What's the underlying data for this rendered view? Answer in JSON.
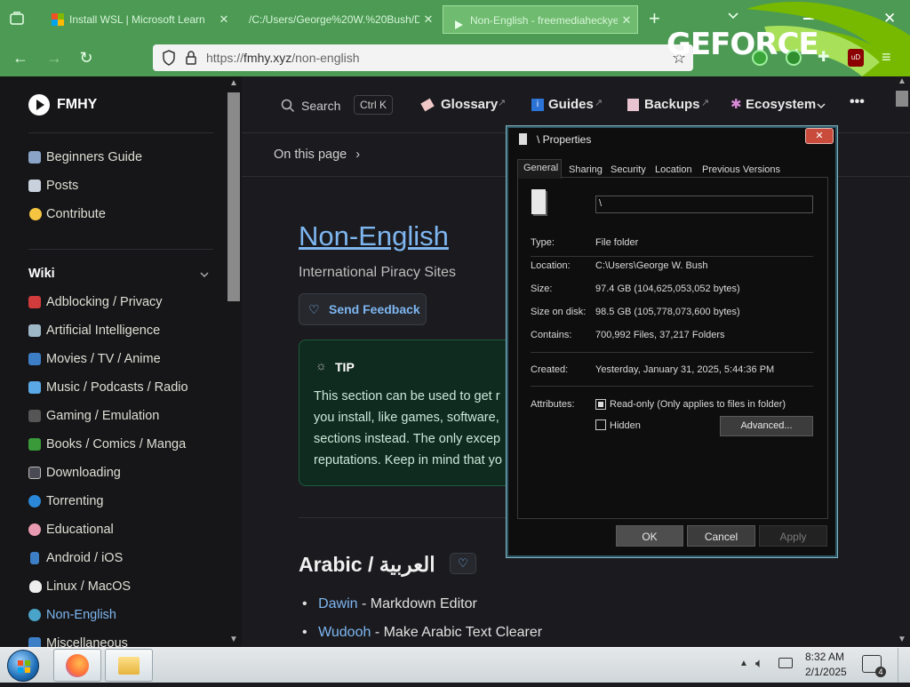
{
  "browser": {
    "tabs": [
      {
        "title": "Install WSL | Microsoft Learn",
        "active": false
      },
      {
        "title": "/C:/Users/George%20W.%20Bush/D",
        "active": false
      },
      {
        "title": "Non-English - freemediaheckyea",
        "active": true
      }
    ],
    "new_tab": "+",
    "url": {
      "prefix": "https://",
      "domain": "fmhy.xyz",
      "path": "/non-english"
    },
    "overlay_brand": "GEFORCE",
    "extension_badge": "uD"
  },
  "site": {
    "logo_text": "FMHY",
    "search_label": "Search",
    "search_shortcut": "Ctrl K",
    "top_nav": [
      "Glossary",
      "Guides",
      "Backups",
      "Ecosystem"
    ],
    "more": "•••",
    "on_this_page": "On this page",
    "sidebar_top": [
      "Beginners Guide",
      "Posts",
      "Contribute"
    ],
    "wiki_label": "Wiki",
    "wiki_items": [
      "Adblocking / Privacy",
      "Artificial Intelligence",
      "Movies / TV / Anime",
      "Music / Podcasts / Radio",
      "Gaming / Emulation",
      "Books / Comics / Manga",
      "Downloading",
      "Torrenting",
      "Educational",
      "Android / iOS",
      "Linux / MacOS",
      "Non-English",
      "Miscellaneous"
    ],
    "active_item": "Non-English",
    "accent": "#7eb6f0",
    "page_title": "Non-English",
    "page_subtitle": "International Piracy Sites",
    "feedback_button": "Send Feedback",
    "tip": {
      "label": "TIP",
      "lines": [
        "This section can be used to get r",
        "you install, like games, software,",
        "sections instead. The only excep",
        "reputations. Keep in mind that yo"
      ]
    },
    "section_heading": "Arabic / العربية",
    "list": [
      {
        "link": "Dawin",
        "desc": " - Markdown Editor"
      },
      {
        "link": "Wudooh",
        "desc": " - Make Arabic Text Clearer"
      }
    ]
  },
  "dialog": {
    "title": "\\ Properties",
    "tabs": [
      "General",
      "Sharing",
      "Security",
      "Location",
      "Previous Versions"
    ],
    "name_value": "\\",
    "fields": [
      {
        "label": "Type:",
        "value": "File folder"
      },
      {
        "label": "Location:",
        "value": "C:\\Users\\George W. Bush"
      },
      {
        "label": "Size:",
        "value": "97.4 GB (104,625,053,052 bytes)"
      },
      {
        "label": "Size on disk:",
        "value": "98.5 GB (105,778,073,600 bytes)"
      },
      {
        "label": "Contains:",
        "value": "700,992 Files, 37,217 Folders"
      },
      {
        "label": "Created:",
        "value": "Yesterday, January 31, 2025, 5:44:36 PM"
      }
    ],
    "attributes_label": "Attributes:",
    "readonly_label": "Read-only (Only applies to files in folder)",
    "hidden_label": "Hidden",
    "advanced_button": "Advanced...",
    "ok": "OK",
    "cancel": "Cancel",
    "apply": "Apply"
  },
  "taskbar": {
    "time": "8:32 AM",
    "date": "2/1/2025",
    "notifications": "4"
  }
}
